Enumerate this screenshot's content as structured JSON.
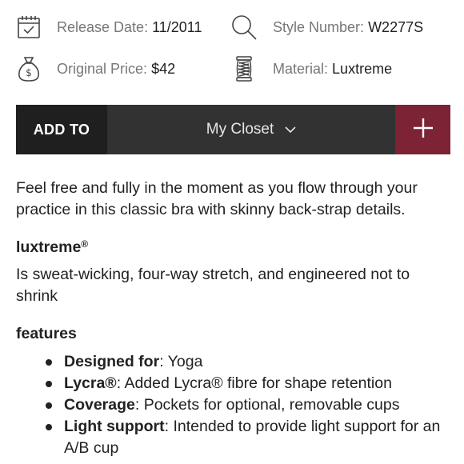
{
  "info": {
    "release": {
      "label": "Release Date:",
      "value": "11/2011",
      "icon": "calendar-icon"
    },
    "style": {
      "label": "Style Number:",
      "value": "W2277S",
      "icon": "search-icon"
    },
    "price": {
      "label": "Original Price:",
      "value": "$42",
      "icon": "money-bag-icon"
    },
    "material": {
      "label": "Material:",
      "value": "Luxtreme",
      "icon": "fabric-spool-icon"
    }
  },
  "add_bar": {
    "add_to_label": "ADD TO",
    "closet_label": "My Closet",
    "colors": {
      "accent": "#7c2336",
      "bar": "#2b2b2b"
    }
  },
  "description": "Feel free and fully in the moment as you flow through your practice in this classic bra with skinny back-strap details.",
  "fabric": {
    "heading": "luxtreme",
    "heading_mark": "®",
    "text": "Is sweat-wicking, four-way stretch, and engineered not to shrink"
  },
  "features": {
    "heading": "features",
    "items": [
      {
        "label": "Designed for",
        "text": ": Yoga"
      },
      {
        "label": "Lycra®",
        "text": ": Added Lycra® fibre for shape retention"
      },
      {
        "label": "Coverage",
        "text": ": Pockets for optional, removable cups"
      },
      {
        "label": "Light support",
        "text": ": Intended to provide light support for an A/B cup"
      }
    ]
  }
}
